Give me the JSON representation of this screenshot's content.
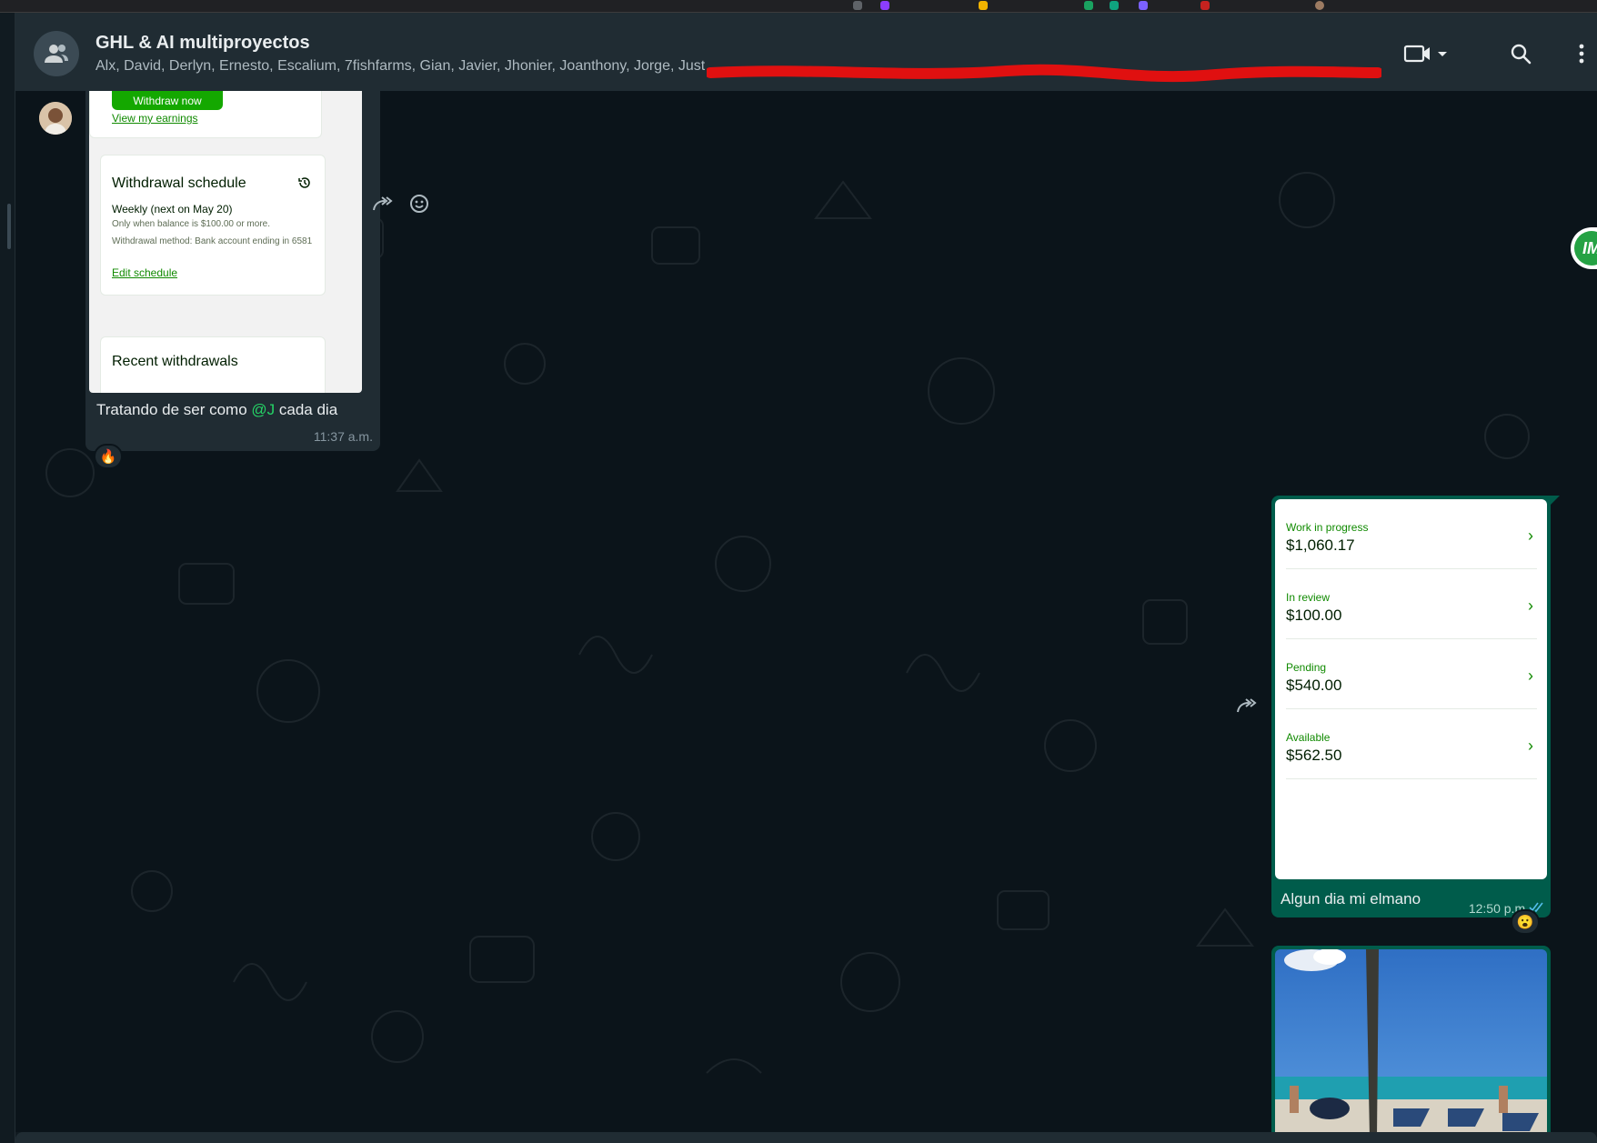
{
  "header": {
    "title": "GHL & AI multiproyectos",
    "members": "Alx, David, Derlyn, Ernesto, Escalium, 7fishfarms, Gian, Javier, Jhonier, Joanthony, Jorge, Just"
  },
  "incoming_message": {
    "screenshot": {
      "withdraw_button": "Withdraw now",
      "view_earnings": "View my earnings",
      "schedule_title": "Withdrawal schedule",
      "schedule_line": "Weekly (next on May 20)",
      "schedule_note": "Only when balance is $100.00 or more.",
      "schedule_method": "Withdrawal method: Bank account ending in 6581",
      "edit_schedule": "Edit schedule",
      "recent_title": "Recent withdrawals"
    },
    "caption_before": "Tratando de ser como ",
    "caption_mention": "@J",
    "caption_after": "  cada dia",
    "time": "11:37 a.m.",
    "reaction": "🔥"
  },
  "outgoing_message": {
    "earnings": [
      {
        "label": "Work in progress",
        "amount": "$1,060.17"
      },
      {
        "label": "In review",
        "amount": "$100.00"
      },
      {
        "label": "Pending",
        "amount": "$540.00"
      },
      {
        "label": "Available",
        "amount": "$562.50"
      }
    ],
    "caption": "Algun dia mi elmano",
    "time": "12:50 p.m.",
    "reaction": "😮"
  },
  "floating_extension": {
    "label": "IM"
  },
  "colors": {
    "header_bg": "#202c33",
    "chat_bg": "#0b141a",
    "incoming_bubble": "#202c33",
    "outgoing_bubble": "#005c4b",
    "accent_green": "#25d366",
    "upwork_green": "#14a800"
  }
}
